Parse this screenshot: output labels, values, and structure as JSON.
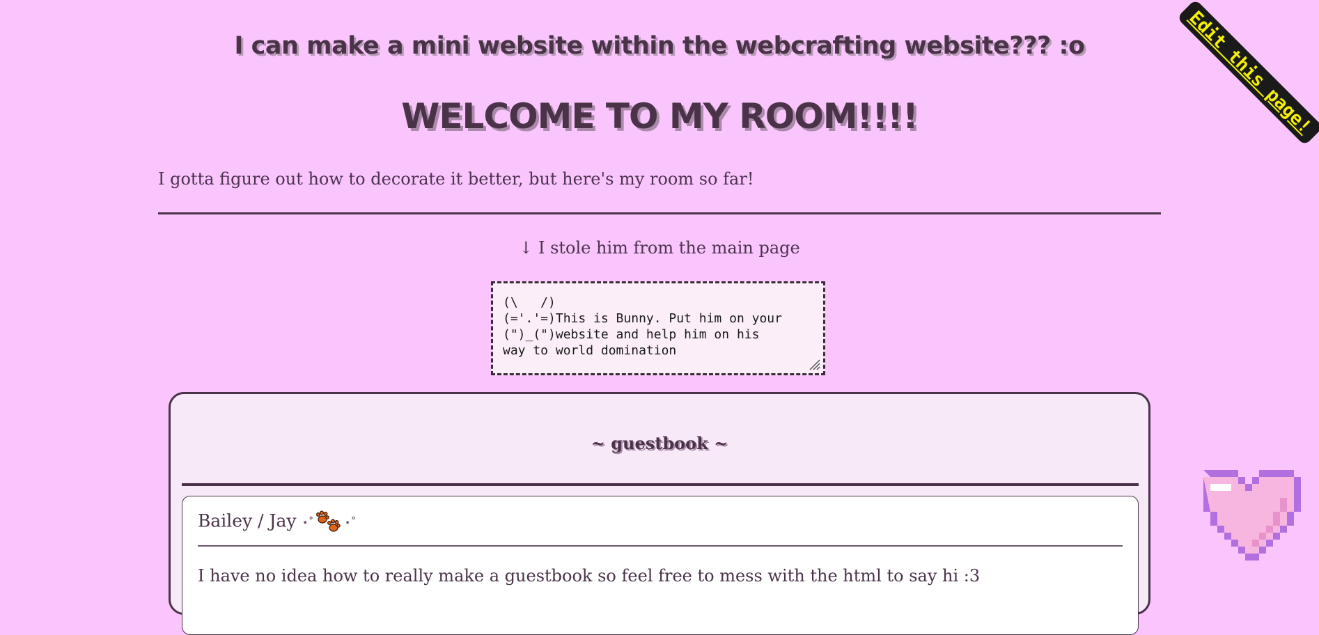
{
  "header": {
    "subtitle": "I can make a mini website within the webcrafting website??? :o",
    "title": "WELCOME TO MY ROOM!!!!"
  },
  "intro_text": "I gotta figure out how to decorate it better, but here's my room so far!",
  "bunny": {
    "caption": "↓ I stole him from the main page",
    "ascii_text": "(\\   /)\n(='.'=)This is Bunny. Put him on your\n(\")_(\")website and help him on his\nway to world domination"
  },
  "guestbook": {
    "title": "~ guestbook ~",
    "entries": [
      {
        "name": "Bailey / Jay",
        "decoration_left": "⋆˚",
        "decoration_right": "⋆˚",
        "icon": "paw-prints-icon",
        "message": "I have no idea how to really make a guestbook so feel free to mess with the html to say hi :3"
      }
    ]
  },
  "edit_link": {
    "label": "Edit this page!"
  },
  "colors": {
    "background": "#f9c5fc",
    "text": "#4a3349",
    "ribbon_bg": "#1a1a1a",
    "ribbon_text": "#f4f000",
    "heart_fill": "#f7b6e0",
    "heart_outline": "#b26fe0"
  }
}
